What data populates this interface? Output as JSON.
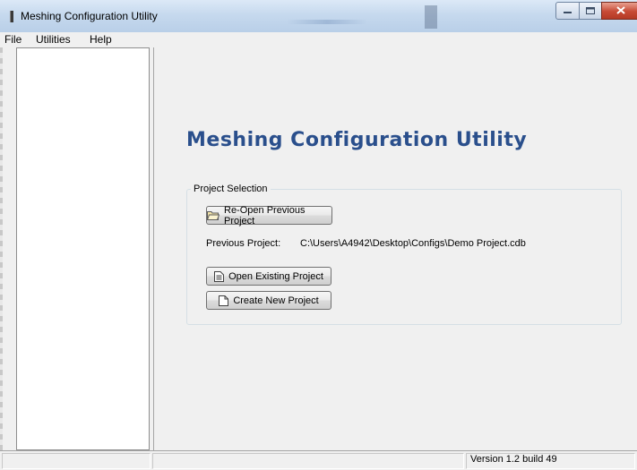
{
  "window": {
    "title": "Meshing Configuration Utility",
    "controls": {
      "minimize_icon": "minimize-icon",
      "maximize_icon": "maximize-icon",
      "close_icon": "close-icon"
    }
  },
  "menu": {
    "items": [
      {
        "label": "File"
      },
      {
        "label": "Utilities"
      },
      {
        "label": "Help"
      }
    ]
  },
  "main": {
    "heading": "Meshing Configuration Utility",
    "heading_color": "#2a4f8c",
    "project_selection": {
      "legend": "Project Selection",
      "reopen_button": {
        "label": "Re-Open Previous Project",
        "icon": "folder-open-icon"
      },
      "previous_project_label": "Previous Project:",
      "previous_project_path": "C:\\Users\\A4942\\Desktop\\Configs\\Demo Project.cdb",
      "open_button": {
        "label": "Open Existing Project",
        "icon": "document-icon"
      },
      "create_button": {
        "label": "Create New Project",
        "icon": "new-file-icon"
      }
    }
  },
  "status_bar": {
    "version": "Version 1.2 build 49"
  }
}
